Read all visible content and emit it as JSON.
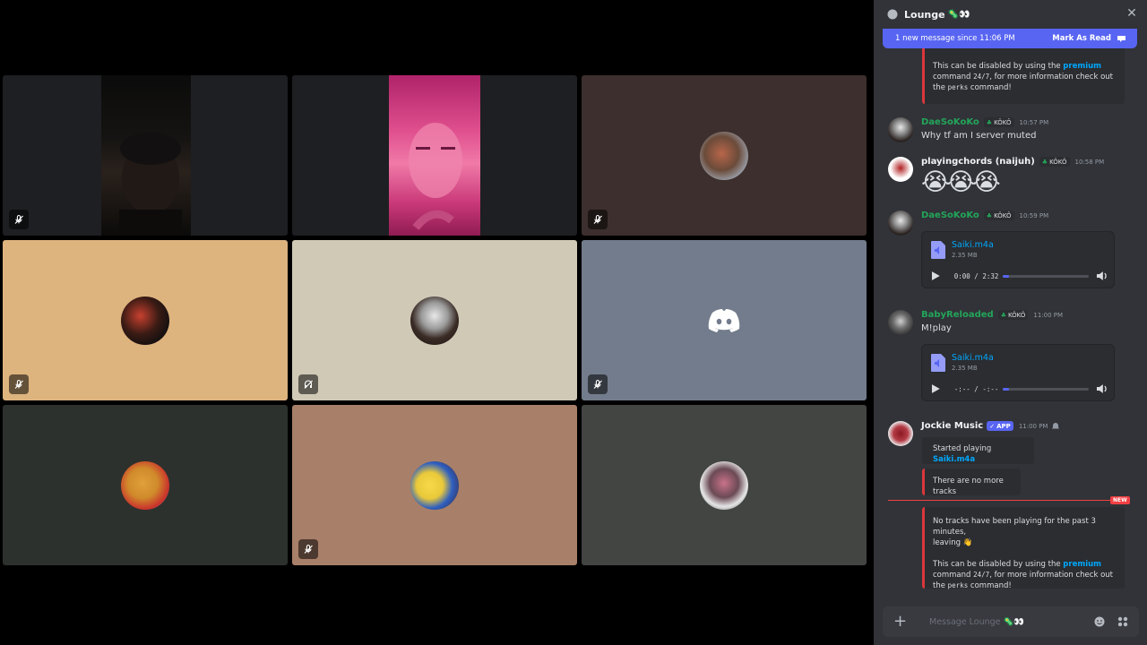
{
  "chat": {
    "channel_name": "Lounge",
    "new_banner": {
      "text": "1 new message since 11:06 PM",
      "mark_label": "Mark As Read"
    },
    "top_embed": {
      "pre": "This can be disabled by using the ",
      "link": "premium",
      "line2": "command ",
      "code1": "24/7",
      "mid": ", for more information check out",
      "line3_pre": "the ",
      "code2": "perks",
      "line3_post": " command!"
    },
    "messages": [
      {
        "author": "DaeSoKoKo",
        "tag": "KÔKÔ",
        "time": "10:57 PM",
        "text": "Why tf am I server muted"
      },
      {
        "author": "playingchords (naijuh)",
        "tag": "KÔKÔ",
        "time": "10:58 PM",
        "text": "😭😭😭"
      },
      {
        "author": "DaeSoKoKo",
        "tag": "KÔKÔ",
        "time": "10:59 PM",
        "text": ""
      },
      {
        "author": "BabyReloaded",
        "tag": "KÔKÔ",
        "time": "11:00 PM",
        "text": "M!play"
      },
      {
        "author": "Jockie Music",
        "tag": "APP",
        "time": "11:00 PM",
        "text": ""
      }
    ],
    "attachments": [
      {
        "filename": "Saiki.m4a",
        "size": "2.35 MB",
        "time": "0:00 / 2:32",
        "progress": 0.07
      },
      {
        "filename": "Saiki.m4a",
        "size": "2.35 MB",
        "time": "-:-- / -:--",
        "progress": 0.07
      }
    ],
    "bot": {
      "started_pre": "Started playing ",
      "started_link": "Saiki.m4a",
      "no_more": "There are no more tracks",
      "leaving_1": "No tracks have been playing for the past 3 minutes,",
      "leaving_2": "leaving 👋",
      "disable_pre": "This can be disabled by using the ",
      "disable_link": "premium",
      "disable_line2": "command ",
      "code1": "24/7",
      "disable_mid": ", for more information check out",
      "line3_pre": "the ",
      "code2": "perks",
      "line3_post": " command!"
    },
    "new_label": "NEW",
    "composer_placeholder": "Message Lounge 🦠👀"
  },
  "icons": {
    "header": "speech-bubble-icon",
    "mute": "muted-mic-icon",
    "deafen": "deafened-icon",
    "discord": "discord-logo-icon"
  },
  "colors": {
    "blurple": "#5865f2",
    "green": "#23a55a",
    "red": "#f23f43",
    "link": "#00a8fc",
    "chat_bg": "#313338"
  }
}
